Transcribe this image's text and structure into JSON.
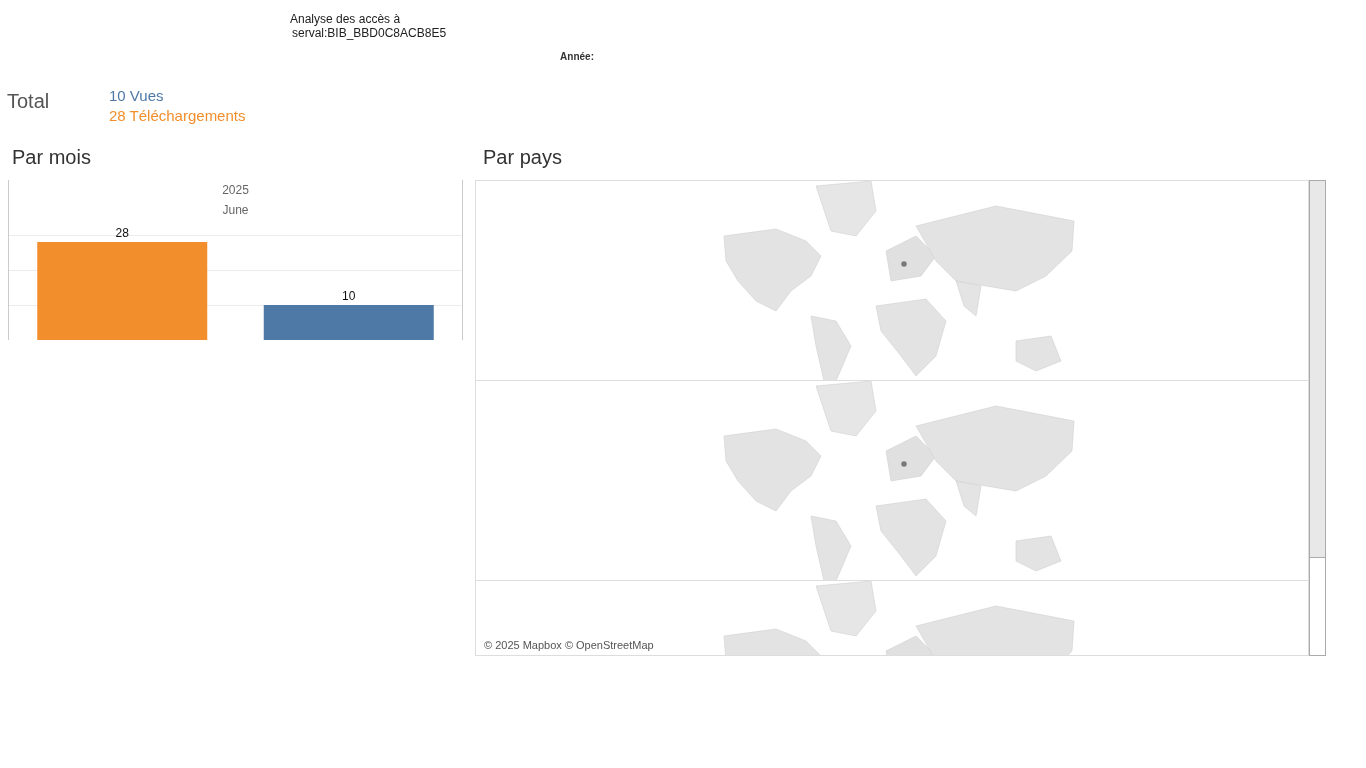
{
  "title": {
    "line_1": "Analyse des accès à",
    "line_2": "serval:BIB_BBD0C8ACB8E5"
  },
  "filter": {
    "label": "Année:"
  },
  "totals": {
    "label": "Total",
    "items": [
      {
        "text": "10 Vues",
        "color": "#4e79a7"
      },
      {
        "text": "28 Téléchargements",
        "color": "#f28e2b"
      }
    ]
  },
  "by_month": {
    "heading": "Par mois",
    "year": "2025",
    "month": "June",
    "chart_data": {
      "type": "bar",
      "series": [
        {
          "color": "#f28e2b",
          "values": [
            28
          ]
        },
        {
          "color": "#4e79a7",
          "values": [
            10
          ]
        }
      ],
      "data_labels": true
    }
  },
  "by_country": {
    "heading": "Par pays",
    "attribution": "© 2025 Mapbox © OpenStreetMap"
  }
}
